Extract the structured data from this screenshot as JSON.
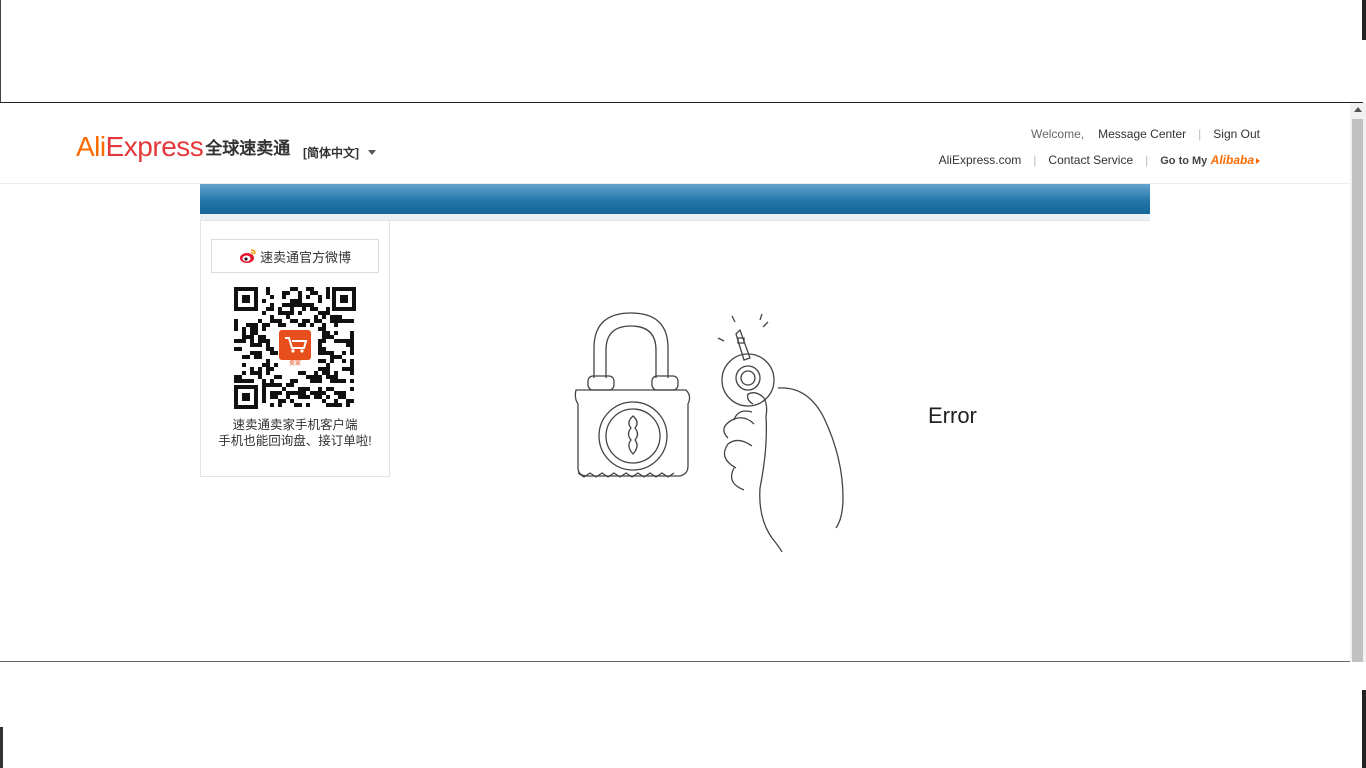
{
  "header": {
    "logo_ali": "Ali",
    "logo_express": "Express",
    "logo_cn": "全球速卖通",
    "language": "[简体中文]",
    "welcome": "Welcome,",
    "message_center": "Message Center",
    "sign_out": "Sign Out",
    "aliexpress_link": "AliExpress.com",
    "contact_service": "Contact Service",
    "goto_my": "Go to My",
    "alibaba": "Alibaba",
    "separator": "|"
  },
  "sidebar": {
    "weibo_label": "速卖通官方微博",
    "app_badge": "卖家",
    "promo_line1": "速卖通卖家手机客户端",
    "promo_line2": "手机也能回询盘、接订单啦!"
  },
  "main": {
    "error_text": "Error"
  },
  "colors": {
    "brand_orange": "#ff6a00",
    "brand_red": "#e4393c",
    "bar_blue": "#1f73a6"
  },
  "icons": [
    "weibo-icon",
    "qr-code",
    "lock-illustration",
    "key-hand-illustration",
    "dropdown-caret-icon"
  ]
}
